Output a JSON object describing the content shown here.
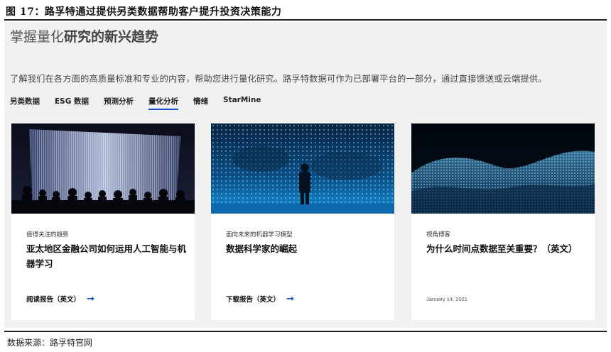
{
  "figure": {
    "caption": "图 17：路孚特通过提供另类数据帮助客户提升投资决策能力",
    "source": "数据来源：路孚特官网"
  },
  "panel": {
    "title_light": "掌握量化",
    "title_bold": "研究的新兴趋势",
    "description": "了解我们在各方面的高质量标准和专业的内容，帮助您进行量化研究。路孚特数据可作为已部署平台的一部分，通过直接馈送或云端提供。",
    "tabs": [
      {
        "label": "另类数据",
        "active": false
      },
      {
        "label": "ESG 数据",
        "active": false
      },
      {
        "label": "预测分析",
        "active": false
      },
      {
        "label": "量化分析",
        "active": true
      },
      {
        "label": "情绪",
        "active": false
      },
      {
        "label": "StarMine",
        "active": false
      }
    ]
  },
  "cards": [
    {
      "category": "值得关注的趋势",
      "title": "亚太地区金融公司如何运用人工智能与机器学习",
      "link_label": "阅读报告（英文）",
      "image": "crowd-light-installation"
    },
    {
      "category": "面向未来的机器学习模型",
      "title": "数据科学家的崛起",
      "link_label": "下载报告（英文）",
      "image": "person-led-wall"
    },
    {
      "category": "视角博客",
      "title": "为什么时间点数据至关重要？（英文）",
      "date": "January 14, 2021",
      "image": "particle-wave"
    }
  ],
  "colors": {
    "accent": "#1a52c7",
    "panel_bg": "#f1f1f1"
  }
}
